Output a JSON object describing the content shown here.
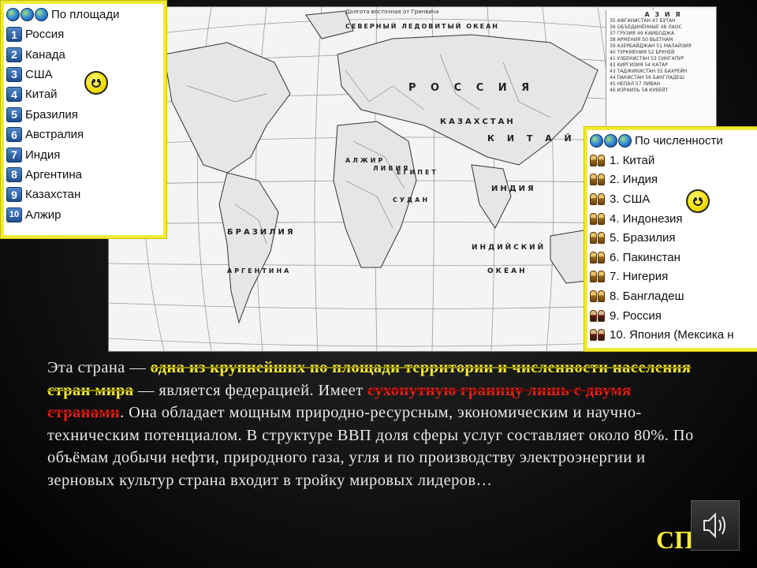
{
  "map": {
    "header_text": "Долгота восточная от Гринвича",
    "legend_title": "А З И Я",
    "legend_lines": [
      "35 АФГАНИСТАН  47 БУТАН",
      "36 ОБЪЕДИНЁННЫЕ  48 ЛАОС",
      "37 ГРУЗИЯ  49 КАМБОДЖА",
      "38 АРМЕНИЯ  50 ВЬЕТНАМ",
      "39 АЗЕРБАЙДЖАН  51 МАЛАЙЗИЯ",
      "40 ТУРКМЕНИЯ  52 БРУНЕЙ",
      "41 УЗБЕКИСТАН  53 СИНГАПУР",
      "42 КИРГИЗИЯ  54 КАТАР",
      "43 ТАДЖИКИСТАН  55 БАХРЕЙН",
      "44 ПАКИСТАН  56 БАНГЛАДЕШ",
      "45 НЕПАЛ  57 ЛИВАН",
      "46 ИЗРАИЛЬ  58 КУВЕЙТ"
    ],
    "labels": {
      "russia": "Р О С С И Я",
      "china": "К И Т А Й",
      "brazil": "БРАЗИЛИЯ",
      "indian_ocean": "ИНДИЙСКИЙ",
      "ocean": "ОКЕАН",
      "india": "ИНДИЯ",
      "kazakhstan": "КАЗАХСТАН",
      "argentina": "АРГЕНТИНА",
      "libya": "ЛИВИЯ",
      "sudan": "СУДАН",
      "egypt": "ЕГИПЕТ",
      "algeria": "АЛЖИР",
      "arctic": "СЕВЕРНЫЙ ЛЕДОВИТЫЙ ОКЕАН"
    }
  },
  "area_panel": {
    "title": "По площади",
    "items": [
      {
        "num": "1",
        "name": "Россия"
      },
      {
        "num": "2",
        "name": "Канада"
      },
      {
        "num": "3",
        "name": "США"
      },
      {
        "num": "4",
        "name": "Китай"
      },
      {
        "num": "5",
        "name": "Бразилия"
      },
      {
        "num": "6",
        "name": "Австралия"
      },
      {
        "num": "7",
        "name": "Индия"
      },
      {
        "num": "8",
        "name": "Аргентина"
      },
      {
        "num": "9",
        "name": "Казахстан"
      },
      {
        "num": "10",
        "name": "Алжир"
      }
    ]
  },
  "pop_panel": {
    "title": "По численности",
    "items": [
      "1. Китай",
      "2. Индия",
      "3. США",
      "4. Индонезия",
      "5. Бразилия",
      "6. Пакинстан",
      "7. Нигерия",
      "8. Бангладеш",
      "9. Россия",
      "10. Япония (Мексика н"
    ]
  },
  "text": {
    "part1": "Эта страна — ",
    "highlight1": "одна из крупнейших по площади территории и численности населения стран мира",
    "part2": " — является федерацией. Имеет ",
    "highlight2": "сухопутную границу лишь с двумя странами",
    "part3": ". Она обладает мощным природно-ресурсным, экономическим и научно-техническим потенциалом. В структуре ВВП доля сферы услуг составляет около 80%. По объёмам добычи нефти, природного газа, угля и по производству электроэнергии и зерновых культур страна входит в тройку мировых лидеров…"
  },
  "footer": {
    "sp_label": "СП"
  },
  "colors": {
    "panel_border": "#f1ea36",
    "highlight_yellow": "#f4ec36",
    "highlight_red": "#e0211b",
    "body_text": "#e8e8e8"
  }
}
